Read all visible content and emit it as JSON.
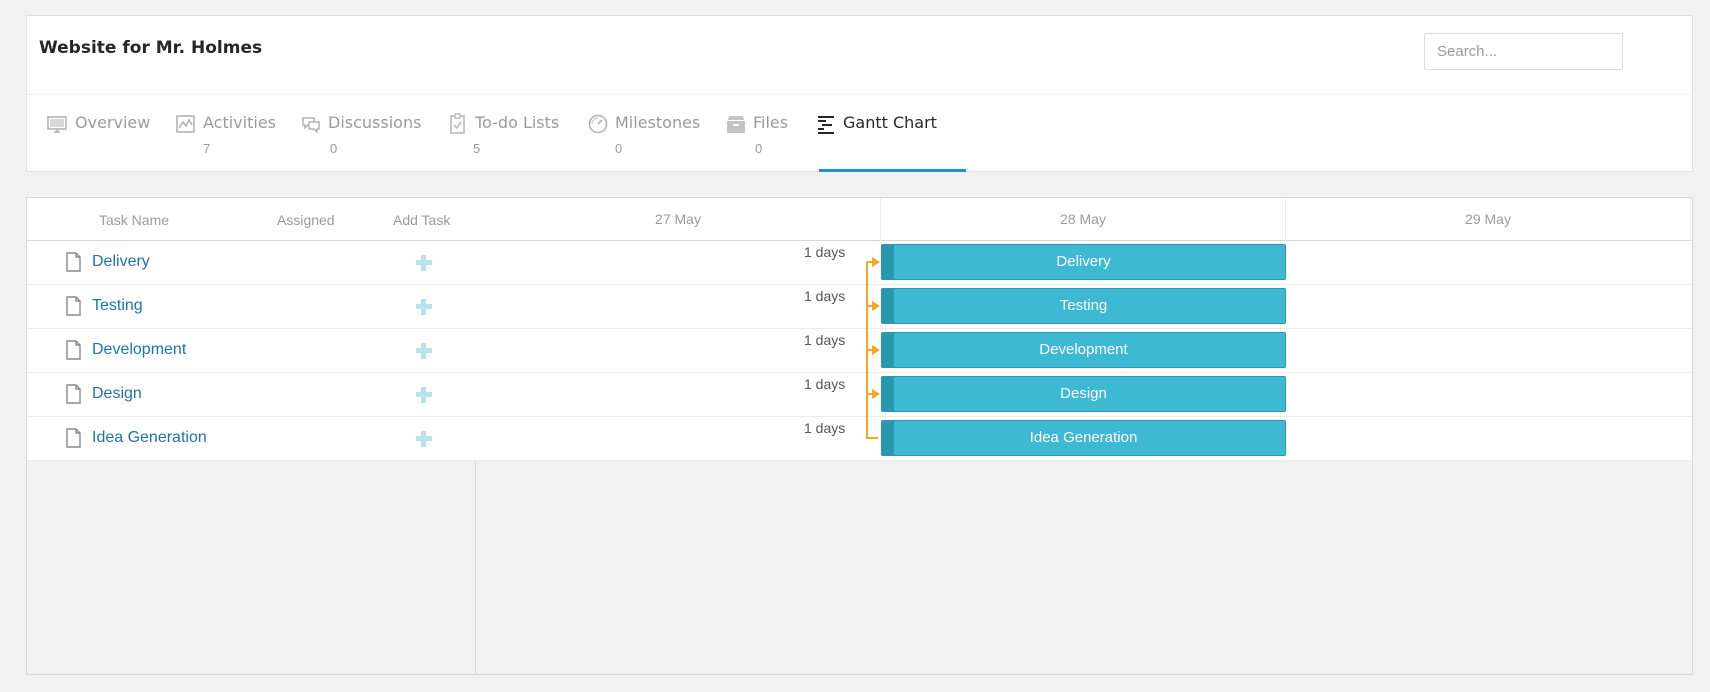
{
  "project": {
    "title": "Website for Mr. Holmes"
  },
  "search": {
    "placeholder": "Search..."
  },
  "tabs": [
    {
      "label": "Overview",
      "count": "",
      "icon": "monitor-icon"
    },
    {
      "label": "Activities",
      "count": "7",
      "icon": "activity-chart-icon"
    },
    {
      "label": "Discussions",
      "count": "0",
      "icon": "chat-bubbles-icon"
    },
    {
      "label": "To-do Lists",
      "count": "5",
      "icon": "clipboard-icon"
    },
    {
      "label": "Milestones",
      "count": "0",
      "icon": "gauge-icon"
    },
    {
      "label": "Files",
      "count": "0",
      "icon": "archive-icon"
    },
    {
      "label": "Gantt Chart",
      "count": "",
      "icon": "gantt-icon",
      "active": true
    }
  ],
  "grid": {
    "columns": {
      "task_name": "Task Name",
      "assigned": "Assigned",
      "add_task": "Add Task"
    },
    "tasks": [
      {
        "name": "Delivery",
        "duration": "1 days",
        "start": "28 May",
        "end": "28 May"
      },
      {
        "name": "Testing",
        "duration": "1 days",
        "start": "28 May",
        "end": "28 May"
      },
      {
        "name": "Development",
        "duration": "1 days",
        "start": "28 May",
        "end": "28 May"
      },
      {
        "name": "Design",
        "duration": "1 days",
        "start": "28 May",
        "end": "28 May"
      },
      {
        "name": "Idea Generation",
        "duration": "1 days",
        "start": "28 May",
        "end": "28 May"
      }
    ]
  },
  "timeline": {
    "dates": [
      "27 May",
      "28 May",
      "29 May"
    ]
  },
  "colors": {
    "bar": "#3db9d3",
    "bar_progress": "#2898b0",
    "link": "#f5a623",
    "accent": "#1a90cf",
    "task_link": "#1f73aa"
  }
}
